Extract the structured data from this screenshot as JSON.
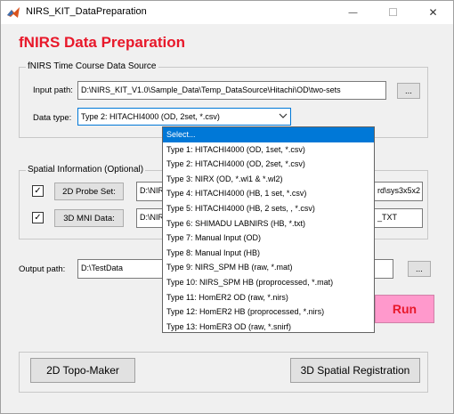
{
  "window": {
    "title": "NIRS_KIT_DataPreparation",
    "minimize_glyph": "—",
    "maximize_glyph": "☐",
    "close_glyph": "✕"
  },
  "header": {
    "title": "fNIRS Data Preparation",
    "title_color": "#e8182a"
  },
  "source_group": {
    "legend": "fNIRS Time Course Data Source",
    "input_path_label": "Input path:",
    "input_path_value": "D:\\NIRS_KIT_V1.0\\Sample_Data\\Temp_DataSource\\Hitachi\\OD\\two-sets",
    "browse_label": "...",
    "data_type_label": "Data type:",
    "data_type_value": "Type 2: HITACHI4000 (OD, 2set, *.csv)"
  },
  "spatial_group": {
    "legend": "Spatial Information (Optional)",
    "probe_set_label": "2D Probe Set:",
    "probe_set_value_left": "D:\\NIR",
    "probe_set_value_right": "rd\\sys3x5x2",
    "mni_label": "3D MNI Data:",
    "mni_value_left": "D:\\NIR",
    "mni_value_right": "_TXT",
    "checkbox_mark": "✓"
  },
  "output": {
    "label": "Output path:",
    "value": "D:\\TestData",
    "browse_label": "..."
  },
  "run_label": "Run",
  "bottom": {
    "topo_maker_label": "2D Topo-Maker",
    "spatial_reg_label": "3D Spatial Registration"
  },
  "dropdown": {
    "options": [
      "Select...",
      "Type 1: HITACHI4000 (OD, 1set, *.csv)",
      "Type 2: HITACHI4000 (OD, 2set, *.csv)",
      "Type 3: NIRX (OD, *.wl1 & *.wl2)",
      "Type 4: HITACHI4000 (HB, 1 set, *.csv)",
      "Type 5: HITACHI4000 (HB, 2 sets, , *.csv)",
      "Type 6: SHIMADU LABNIRS (HB, *.txt)",
      "Type 7: Manual Input (OD)",
      "Type 8: Manual Input (HB)",
      "Type 9: NIRS_SPM HB (raw, *.mat)",
      "Type 10: NIRS_SPM HB (proprocessed, *.mat)",
      "Type 11: HomER2 OD (raw, *.nirs)",
      "Type 12: HomER2 HB (proprocessed, *.nirs)",
      "Type 13: HomER3 OD  (raw, *.snirf)"
    ],
    "highlight_color": "#0078d7"
  }
}
